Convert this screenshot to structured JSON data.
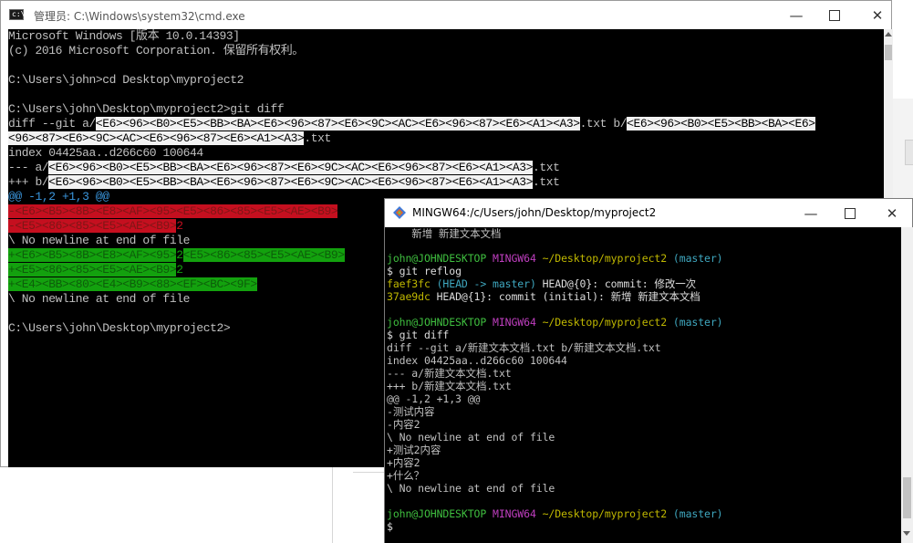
{
  "cmd": {
    "title": "管理员: C:\\Windows\\system32\\cmd.exe",
    "lines": {
      "l1": "Microsoft Windows [版本 10.0.14393]",
      "l2": "(c) 2016 Microsoft Corporation. 保留所有权利。",
      "l4": "C:\\Users\\john>cd Desktop\\myproject2",
      "l6": "C:\\Users\\john\\Desktop\\myproject2>git diff",
      "l7a": "diff --git a/",
      "l7b": "<E6><96><B0><E5><BB><BA><E6><96><87><E6><9C><AC><E6><96><87><E6><A1><A3>",
      "l7c": ".txt b/",
      "l7d": "<E6><96><B0><E5><BB><BA><E6>",
      "l8a": "<96><87><E6><9C><AC><E6><96><87><E6><A1><A3>",
      "l8b": ".txt",
      "l9": "index 04425aa..d266c60 100644",
      "l10a": "--- a/",
      "l10b": "<E6><96><B0><E5><BB><BA><E6><96><87><E6><9C><AC><E6><96><87><E6><A1><A3>",
      "l10c": ".txt",
      "l11a": "+++ b/",
      "l11b": "<E6><96><B0><E5><BB><BA><E6><96><87><E6><9C><AC><E6><96><87><E6><A1><A3>",
      "l11c": ".txt",
      "l12": "@@ -1,2 +1,3 @@",
      "l13": "-<E6><B5><8B><E8><AF><95><E5><86><85><E5><AE><B9>",
      "l14a": "-<E5><86><85><E5><AE><B9>",
      "l14b": "2",
      "l15": "\\ No newline at end of file",
      "l16a": "+<E6><B5><8B><E8><AF><95>",
      "l16b": "2",
      "l16c": "<E5><86><85><E5><AE><B9>",
      "l17a": "+<E5><86><85><E5><AE><B9>",
      "l17b": "2",
      "l18": "+<E4><BB><80><E4><B9><88><EF><BC><9F>",
      "l19": "\\ No newline at end of file",
      "l21": "C:\\Users\\john\\Desktop\\myproject2>"
    }
  },
  "mingw": {
    "title": "MINGW64:/c/Users/john/Desktop/myproject2",
    "user_host": "john@JOHNDESKTOP",
    "env": "MINGW64",
    "path": "~/Desktop/myproject2",
    "branch": "(master)",
    "prompt": "$",
    "lines": {
      "m0": "    新增 新建文本文档",
      "m2": "git reflog",
      "m3a": "faef3fc",
      "m3b": "(HEAD -> master)",
      "m3c": "HEAD@{0}: commit: 修改一次",
      "m4a": "37ae9dc",
      "m4b": "HEAD@{1}: commit (initial): 新增 新建文本文档",
      "m7": "git diff",
      "m8": "diff --git a/新建文本文档.txt b/新建文本文档.txt",
      "m9": "index 04425aa..d266c60 100644",
      "m10": "--- a/新建文本文档.txt",
      "m11": "+++ b/新建文本文档.txt",
      "m12": "@@ -1,2 +1,3 @@",
      "m13": "-测试内容",
      "m14": "-内容2",
      "m15": "\\ No newline at end of file",
      "m16": "+测试2内容",
      "m17": "+内容2",
      "m18": "+什么？",
      "m19": "\\ No newline at end of file"
    }
  }
}
